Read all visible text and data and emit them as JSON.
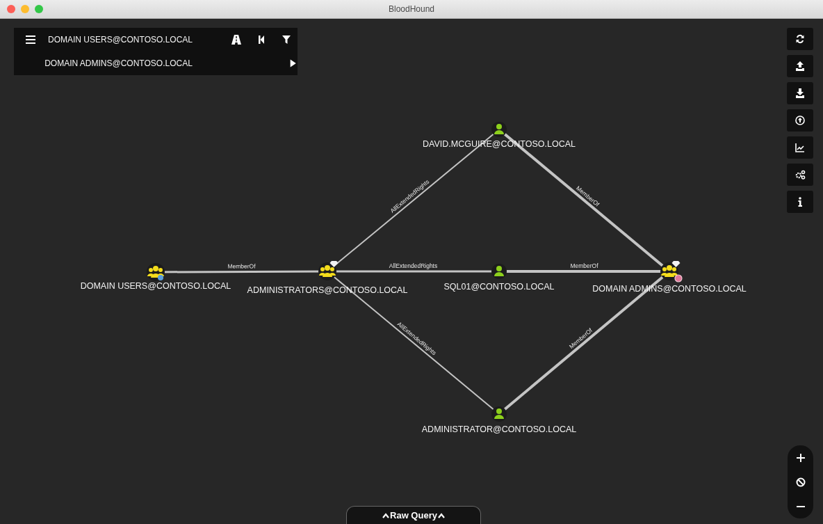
{
  "window": {
    "title": "BloodHound"
  },
  "query": {
    "start": "DOMAIN USERS@CONTOSO.LOCAL",
    "target": "DOMAIN ADMINS@CONTOSO.LOCAL"
  },
  "graph": {
    "nodes": [
      {
        "label": "DOMAIN USERS@CONTOSO.LOCAL",
        "kind": "group",
        "high_value": false,
        "start": true,
        "target": false
      },
      {
        "label": "ADMINISTRATORS@CONTOSO.LOCAL",
        "kind": "group",
        "high_value": true,
        "start": false,
        "target": false
      },
      {
        "label": "DAVID.MCGUIRE@CONTOSO.LOCAL",
        "kind": "user",
        "high_value": false,
        "start": false,
        "target": false
      },
      {
        "label": "SQL01@CONTOSO.LOCAL",
        "kind": "user",
        "high_value": false,
        "start": false,
        "target": false
      },
      {
        "label": "DOMAIN ADMINS@CONTOSO.LOCAL",
        "kind": "group",
        "high_value": true,
        "start": false,
        "target": true
      },
      {
        "label": "ADMINISTRATOR@CONTOSO.LOCAL",
        "kind": "user",
        "high_value": false,
        "start": false,
        "target": false
      }
    ],
    "edges": [
      {
        "label": "MemberOf"
      },
      {
        "label": "AllExtendedRights"
      },
      {
        "label": "MemberOf"
      },
      {
        "label": "AllExtendedRights"
      },
      {
        "label": "MemberOf"
      },
      {
        "label": "AllExtendedRights"
      },
      {
        "label": "MemberOf"
      }
    ]
  },
  "raw_query": {
    "label": "Raw Query"
  }
}
